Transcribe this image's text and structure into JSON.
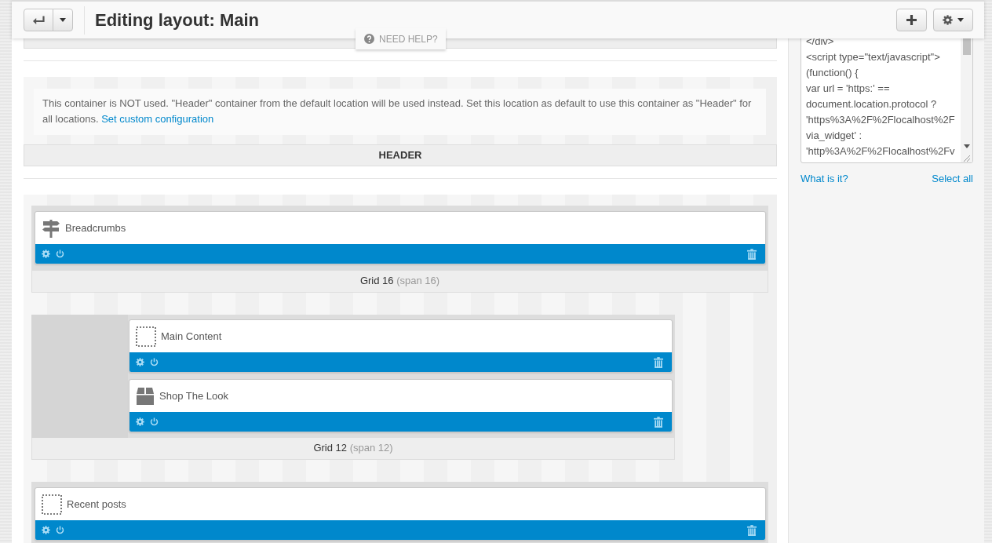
{
  "header": {
    "title": "Editing layout: Main",
    "help": "NEED HELP?"
  },
  "containers": [
    {
      "notice": {
        "text": "This container is NOT used. \"Header\" container from the default location will be used instead. Set this location as default to use this container as \"Header\" for all locations.",
        "link": "Set custom configuration"
      },
      "label": "HEADER"
    },
    {
      "grids": [
        {
          "kind": "full",
          "label": "Grid 16",
          "span": "(span 16)",
          "widgets": [
            {
              "kind": "signpost",
              "name": "Breadcrumbs"
            }
          ]
        },
        {
          "kind": "offset",
          "label": "Grid 12",
          "span": "(span 12)",
          "widgets": [
            {
              "kind": "blank",
              "name": "Main Content"
            },
            {
              "kind": "box",
              "name": "Shop The Look"
            }
          ]
        },
        {
          "kind": "full",
          "widgets": [
            {
              "kind": "blank",
              "name": "Recent posts"
            }
          ]
        }
      ]
    }
  ],
  "sidebar": {
    "code_lines": [
      "</div>",
      "<script type=\"text/javascript\">",
      "(function() {",
      "var url = 'https:' ==",
      "document.location.protocol ?",
      "'https%3A%2F%2Flocalhost%2F",
      "via_widget' :",
      "'http%3A%2F%2Flocalhost%2Fv"
    ],
    "links": [
      "What is it?",
      "Select all"
    ]
  }
}
